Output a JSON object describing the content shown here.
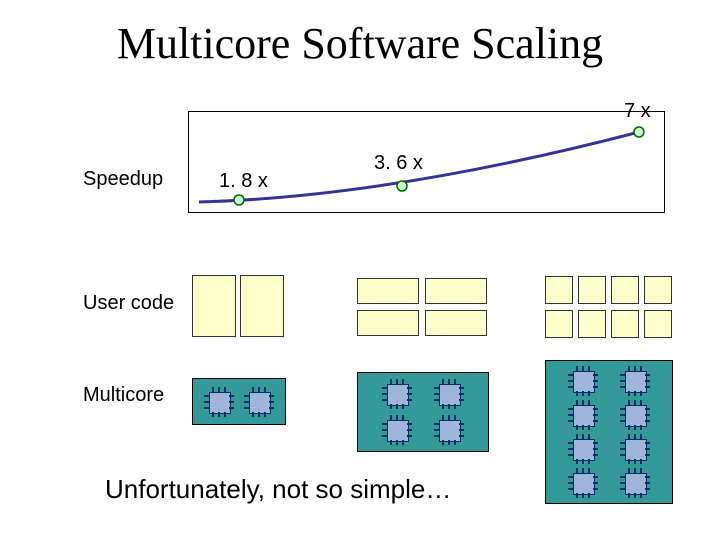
{
  "title": "Multicore Software Scaling",
  "rows": {
    "speedup": "Speedup",
    "usercode": "User code",
    "multicore": "Multicore"
  },
  "caption": "Unfortunately, not so simple…",
  "chart_data": {
    "type": "line",
    "title": "Speedup vs cores",
    "xlabel": "",
    "ylabel": "Speedup",
    "categories": [
      "2 cores",
      "4 cores",
      "8 cores"
    ],
    "values": [
      1.8,
      3.6,
      7
    ],
    "labels": [
      "1. 8 x",
      "3. 6 x",
      "7 x"
    ],
    "ylim": [
      1,
      8
    ]
  },
  "configs": [
    {
      "cores": 2,
      "user_boxes": 2
    },
    {
      "cores": 4,
      "user_boxes": 4
    },
    {
      "cores": 8,
      "user_boxes": 8
    }
  ],
  "colors": {
    "chart_line": "#333399",
    "marker_fill": "#ccffcc",
    "usercode_fill": "#ffffcc",
    "multicore_fill": "#339999",
    "chip_die": "#9fb5d9",
    "chip_pin": "#0a2f66"
  }
}
